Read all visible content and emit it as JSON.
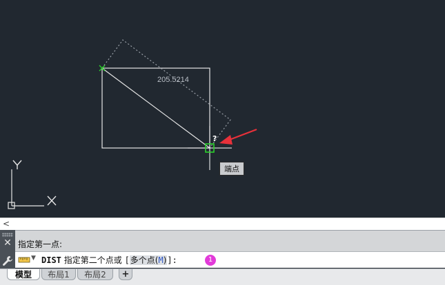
{
  "viewport": {
    "dimension_label": "205.5214",
    "cursor_hint": "?",
    "snap_tooltip": "端点",
    "ucs": {
      "y_label": "Y",
      "x_label": "X"
    }
  },
  "command_line": {
    "collapse_glyph": "<",
    "history_line": "指定第一点:",
    "current_command": "DIST",
    "prompt_text": "指定第二个点或 ",
    "bracket_open": "[",
    "option_label": "多个点(",
    "option_key": "M",
    "option_close": ")",
    "bracket_close": "]:",
    "step_badge": "1"
  },
  "layout_tabs": {
    "model": "模型",
    "layout1": "布局1",
    "layout2": "布局2",
    "add": "+"
  },
  "colors": {
    "canvas_bg": "#212830",
    "geometry": "#e6e6e6",
    "dimension": "#b9bec6",
    "snap_marker": "#2bd22b",
    "arrow": "#e8313a",
    "badge": "#e23bd9"
  }
}
